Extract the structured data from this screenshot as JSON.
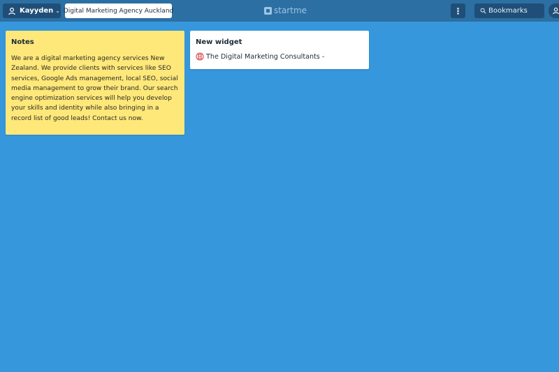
{
  "header": {
    "user_name": "Kayyden",
    "page_title": "Digital Marketing Agency Auckland",
    "logo_text": "startme",
    "more_label": "⋮",
    "search_placeholder": "Bookmarks"
  },
  "notes_widget": {
    "title": "Notes",
    "body": "We are a digital marketing agency services New Zealand. We provide clients with services like SEO services, Google Ads management, local SEO, social media management to grow their brand. Our search engine optimization services will help you develop your skills and identity while also bringing in a record list of good leads! Contact us now."
  },
  "bookmark_widget": {
    "title": "New widget",
    "items": [
      {
        "label": "The Digital Marketing Consultants -",
        "icon": "favicon-icon"
      }
    ]
  },
  "colors": {
    "background": "#3797dc",
    "topbar": "#2c6fa3",
    "button_dark": "#1f4f78",
    "notes_yellow": "#fee87a",
    "widget_white": "#ffffff"
  }
}
